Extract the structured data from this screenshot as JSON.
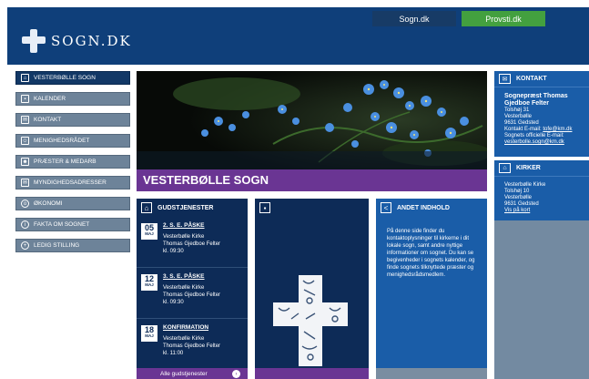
{
  "header": {
    "logo_text": "SOGN.DK",
    "tabs": [
      {
        "label": "Sogn.dk"
      },
      {
        "label": "Provsti.dk"
      }
    ]
  },
  "sidebar": {
    "items": [
      {
        "label": "VESTERBØLLE SOGN",
        "icon": "church-icon"
      },
      {
        "label": "KALENDER",
        "icon": "calendar-icon"
      },
      {
        "label": "KONTAKT",
        "icon": "mail-icon"
      },
      {
        "label": "MENIGHEDSRÅDET",
        "icon": "person-icon"
      },
      {
        "label": "PRÆSTER & MEDARB",
        "icon": "people-icon"
      },
      {
        "label": "MYNDIGHEDSADRESSER",
        "icon": "mail-icon"
      },
      {
        "label": "ØKONOMI",
        "icon": "coin-icon"
      },
      {
        "label": "FAKTA OM SOGNET",
        "icon": "info-icon"
      },
      {
        "label": "LEDIG STILLING",
        "icon": "plus-icon"
      }
    ]
  },
  "hero": {
    "title": "VESTERBØLLE SOGN"
  },
  "services": {
    "heading": "GUDSTJENESTER",
    "items": [
      {
        "day": "05",
        "month": "MAJ",
        "title": "2. S. E. PÅSKE",
        "church": "Vesterbølle Kirke",
        "priest": "Thomas Gjedboe Felter",
        "time": "kl. 09:30"
      },
      {
        "day": "12",
        "month": "MAJ",
        "title": "3. S. E. PÅSKE",
        "church": "Vesterbølle Kirke",
        "priest": "Thomas Gjedboe Felter",
        "time": "kl. 09:30"
      },
      {
        "day": "18",
        "month": "MAJ",
        "title": "KONFIRMATION",
        "church": "Vesterbølle Kirke",
        "priest": "Thomas Gjedboe Felter",
        "time": "kl. 11:00"
      }
    ],
    "all_link": "Alle gudstjenester"
  },
  "other_content": {
    "heading": "ANDET INDHOLD",
    "text": "På denne side finder du kontaktoplysninger til kirkerne i dit lokale sogn, samt andre nyttige informationer om sognet. Du kan se begivenheder i sognets kalender, og finde sognets tilknyttede præster og menighedsrådsmedlem."
  },
  "contact": {
    "heading": "KONTAKT",
    "name": "Sognepræst Thomas Gjedboe Felter",
    "address1": "Tolshøj 31",
    "address2": "Vesterbølle",
    "postal": "9631 Gedsted",
    "email_label": "Kontakt E-mail:",
    "email": "tofe@km.dk",
    "official_label": "Sognets officielle E-mail:",
    "official_email": "vesterbolle.sogn@km.dk"
  },
  "churches": {
    "heading": "KIRKER",
    "name": "Vesterbølle Kirke",
    "address1": "Tolshøj 10",
    "address2": "Vesterbølle",
    "postal": "9631 Gedsted",
    "map_link": "Vis på kort"
  },
  "colors": {
    "header": "#0f3f7a",
    "purple": "#6a3593",
    "navy": "#0d2b57",
    "blue": "#1a5da8",
    "green": "#43a03f"
  }
}
